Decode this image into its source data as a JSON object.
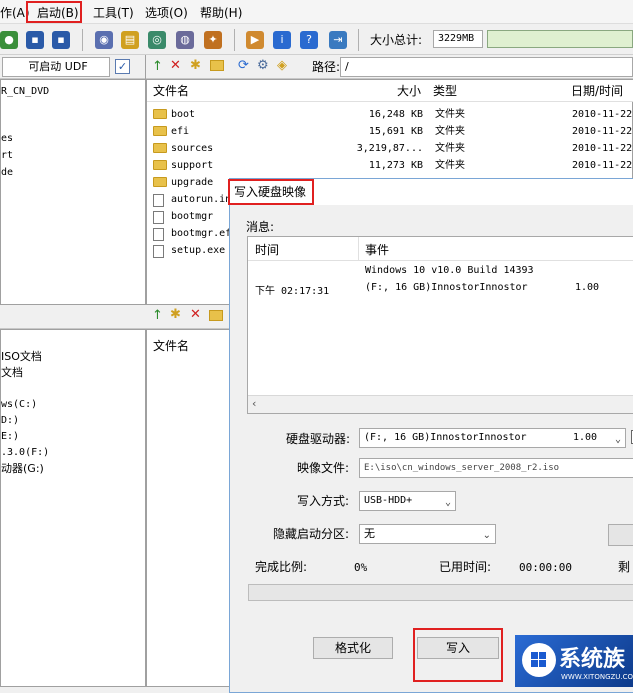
{
  "menu": {
    "items": [
      {
        "label": "作(A)"
      },
      {
        "label": "启动(B)"
      },
      {
        "label": "工具(T)"
      },
      {
        "label": "选项(O)"
      },
      {
        "label": "帮助(H)"
      }
    ]
  },
  "toolbar": {
    "size_total_label": "大小总计:",
    "size_total_value": "3229MB"
  },
  "boot_bar": {
    "volume_label": "可启动 UDF",
    "path_label": "路径:",
    "path_value": "/"
  },
  "left_tree": {
    "top_items": [
      "R_CN_DVD",
      "es",
      "rt",
      "de"
    ],
    "bottom_items": [
      "ISO文档",
      "文档",
      "ws(C:)",
      "D:)",
      "E:)",
      ".3.0(F:)",
      "动器(G:)"
    ]
  },
  "file_list": {
    "columns": [
      "文件名",
      "大小",
      "类型",
      "日期/时间"
    ],
    "rows": [
      {
        "name": "boot",
        "size": "16,248 KB",
        "type": "文件夹",
        "date": "2010-11-22",
        "icon": "folder"
      },
      {
        "name": "efi",
        "size": "15,691 KB",
        "type": "文件夹",
        "date": "2010-11-22",
        "icon": "folder"
      },
      {
        "name": "sources",
        "size": "3,219,87...",
        "type": "文件夹",
        "date": "2010-11-22",
        "icon": "folder"
      },
      {
        "name": "support",
        "size": "11,273 KB",
        "type": "文件夹",
        "date": "2010-11-22",
        "icon": "folder"
      },
      {
        "name": "upgrade",
        "size": "",
        "type": "",
        "date": "",
        "icon": "folder"
      },
      {
        "name": "autorun.in",
        "size": "",
        "type": "",
        "date": "",
        "icon": "file"
      },
      {
        "name": "bootmgr",
        "size": "",
        "type": "",
        "date": "",
        "icon": "file"
      },
      {
        "name": "bootmgr.ef",
        "size": "",
        "type": "",
        "date": "",
        "icon": "file"
      },
      {
        "name": "setup.exe",
        "size": "",
        "type": "",
        "date": "",
        "icon": "file"
      }
    ]
  },
  "lower_list": {
    "column": "文件名"
  },
  "dialog": {
    "title": "写入硬盘映像",
    "messages_label": "消息:",
    "log_columns": [
      "时间",
      "事件"
    ],
    "log_rows": [
      {
        "time": "",
        "event": "Windows 10 v10.0 Build 14393",
        "extra": ""
      },
      {
        "time": "下午 02:17:31",
        "event": "(F:, 16 GB)InnostorInnostor",
        "extra": "1.00"
      }
    ],
    "drive_label": "硬盘驱动器:",
    "drive_value": "(F:, 16 GB)InnostorInnostor",
    "drive_version": "1.00",
    "image_label": "映像文件:",
    "image_value": "E:\\iso\\cn_windows_server_2008_r2.iso",
    "write_mode_label": "写入方式:",
    "write_mode_value": "USB-HDD+",
    "hidden_part_label": "隐藏启动分区:",
    "hidden_part_value": "无",
    "progress_label": "完成比例:",
    "progress_value": "0%",
    "elapsed_label": "已用时间:",
    "elapsed_value": "00:00:00",
    "remaining_label": "剩",
    "format_button": "格式化",
    "write_button": "写入"
  },
  "watermark": {
    "brand": "系统族",
    "url": "WWW.XITONGZU.COM"
  }
}
